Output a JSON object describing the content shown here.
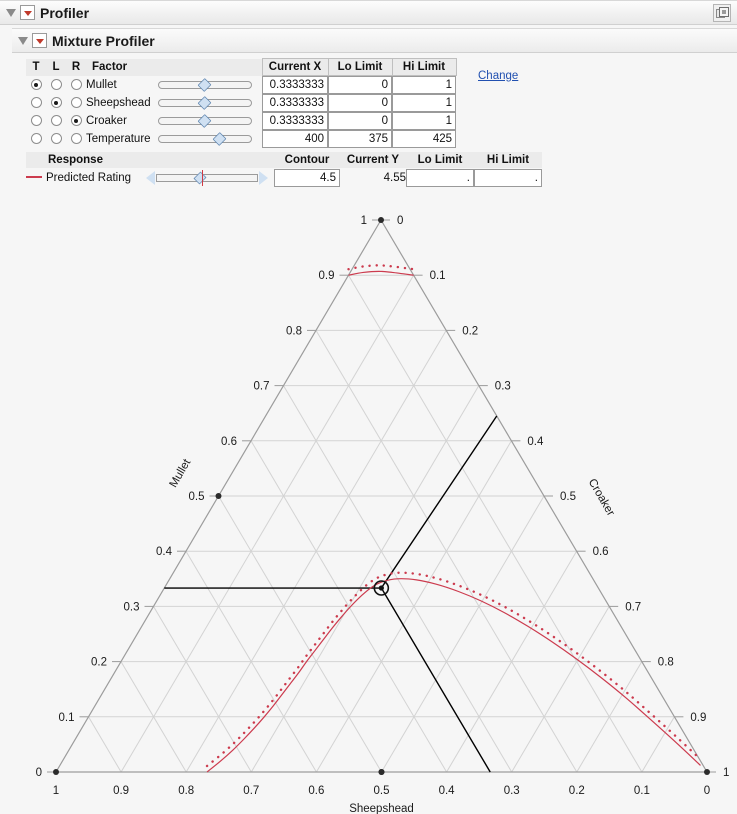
{
  "window": {
    "outer_title": "Profiler",
    "inner_title": "Mixture Profiler",
    "corner_icon": "fit-window-icon"
  },
  "factor_table": {
    "headers": {
      "t": "T",
      "l": "L",
      "r": "R",
      "factor": "Factor",
      "current_x": "Current X",
      "lo_limit": "Lo Limit",
      "hi_limit": "Hi Limit"
    },
    "change_link": "Change",
    "rows": [
      {
        "name": "Mullet",
        "t": true,
        "l": false,
        "r": false,
        "current_x": "0.3333333",
        "lo": "0",
        "hi": "1",
        "slider_pct": 33.3
      },
      {
        "name": "Sheepshead",
        "t": false,
        "l": true,
        "r": false,
        "current_x": "0.3333333",
        "lo": "0",
        "hi": "1",
        "slider_pct": 33.3
      },
      {
        "name": "Croaker",
        "t": false,
        "l": false,
        "r": true,
        "current_x": "0.3333333",
        "lo": "0",
        "hi": "1",
        "slider_pct": 33.3
      },
      {
        "name": "Temperature",
        "t": false,
        "l": false,
        "r": false,
        "current_x": "400",
        "lo": "375",
        "hi": "425",
        "slider_pct": 50.0
      }
    ]
  },
  "response_table": {
    "headers": {
      "response": "Response",
      "contour": "Contour",
      "current_y": "Current Y",
      "lo_limit": "Lo Limit",
      "hi_limit": "Hi Limit"
    },
    "rows": [
      {
        "name": "Predicted Rating",
        "contour": "4.5",
        "current_y": "4.55",
        "lo": ".",
        "hi": ".",
        "color": "#cc3b4e"
      }
    ]
  },
  "chart_data": {
    "type": "ternary-contour",
    "title": "Mixture Profiler",
    "axes": [
      {
        "name": "Mullet",
        "position": "left",
        "ticks": [
          0,
          0.1,
          0.2,
          0.3,
          0.4,
          0.5,
          0.6,
          0.7,
          0.8,
          0.9,
          1
        ]
      },
      {
        "name": "Sheepshead",
        "position": "bottom",
        "ticks": [
          1,
          0.9,
          0.8,
          0.7,
          0.6,
          0.5,
          0.4,
          0.3,
          0.2,
          0.1,
          0
        ]
      },
      {
        "name": "Croaker",
        "position": "right",
        "ticks": [
          0,
          0.1,
          0.2,
          0.3,
          0.4,
          0.5,
          0.6,
          0.7,
          0.8,
          0.9,
          1
        ]
      }
    ],
    "grid": true,
    "current_point": {
      "mullet": 0.3333333,
      "sheepshead": 0.3333333,
      "croaker": 0.3333333,
      "label": "current-mixture-crosshair"
    },
    "contour_level": 4.5,
    "contours": [
      {
        "name": "Predicted Rating = 4.5 (lower branch)",
        "color": "#cc3b4e",
        "style": "solid",
        "points_mullet_sheepshead": [
          [
            0.0,
            0.768
          ],
          [
            0.02,
            0.737
          ],
          [
            0.04,
            0.708
          ],
          [
            0.06,
            0.681
          ],
          [
            0.08,
            0.655
          ],
          [
            0.1,
            0.63
          ],
          [
            0.12,
            0.606
          ],
          [
            0.14,
            0.583
          ],
          [
            0.16,
            0.56
          ],
          [
            0.18,
            0.537
          ],
          [
            0.2,
            0.515
          ],
          [
            0.22,
            0.492
          ],
          [
            0.24,
            0.469
          ],
          [
            0.26,
            0.446
          ],
          [
            0.28,
            0.422
          ],
          [
            0.3,
            0.397
          ],
          [
            0.32,
            0.37
          ],
          [
            0.335,
            0.347
          ],
          [
            0.345,
            0.325
          ],
          [
            0.35,
            0.3
          ],
          [
            0.348,
            0.272
          ],
          [
            0.34,
            0.245
          ],
          [
            0.327,
            0.218
          ],
          [
            0.31,
            0.192
          ],
          [
            0.289,
            0.167
          ],
          [
            0.264,
            0.143
          ],
          [
            0.236,
            0.12
          ],
          [
            0.205,
            0.098
          ],
          [
            0.171,
            0.077
          ],
          [
            0.134,
            0.057
          ],
          [
            0.095,
            0.039
          ],
          [
            0.054,
            0.021
          ],
          [
            0.012,
            0.004
          ]
        ]
      },
      {
        "name": "Predicted Rating = 4.5 (upper branch near Mullet apex)",
        "color": "#cc3b4e",
        "style": "solid",
        "points_mullet_sheepshead": [
          [
            0.9,
            0.1
          ],
          [
            0.905,
            0.075
          ],
          [
            0.907,
            0.05
          ],
          [
            0.905,
            0.03
          ],
          [
            0.9,
            0.0
          ]
        ]
      }
    ],
    "constraint_lines": [
      {
        "name": "constraint-horizontal",
        "color": "#000000",
        "from_mullet_sheepshead": [
          0.3333,
          0.6667
        ],
        "to_mullet_sheepshead": [
          0.3333,
          0.3333
        ]
      },
      {
        "name": "constraint-upper-right",
        "color": "#000000",
        "from_mullet_sheepshead": [
          0.3333,
          0.3333
        ],
        "to_mullet_sheepshead": [
          0.645,
          0.0
        ]
      },
      {
        "name": "constraint-lower-right",
        "color": "#000000",
        "from_mullet_sheepshead": [
          0.3333,
          0.3333
        ],
        "to_mullet_sheepshead": [
          0.0,
          0.333
        ]
      }
    ],
    "edge_markers": [
      {
        "name": "left-edge-0.5",
        "mullet": 0.5,
        "sheepshead": 0.5
      },
      {
        "name": "right-edge-0.5",
        "mullet": 0.0,
        "sheepshead": 0.5
      },
      {
        "name": "bottom-0.5",
        "mullet": 0.0,
        "sheepshead": 0.5
      },
      {
        "name": "apex",
        "mullet": 1.0,
        "sheepshead": 0.0
      },
      {
        "name": "bottom-left",
        "mullet": 0.0,
        "sheepshead": 1.0
      },
      {
        "name": "bottom-right",
        "mullet": 0.0,
        "sheepshead": 0.0
      }
    ]
  }
}
